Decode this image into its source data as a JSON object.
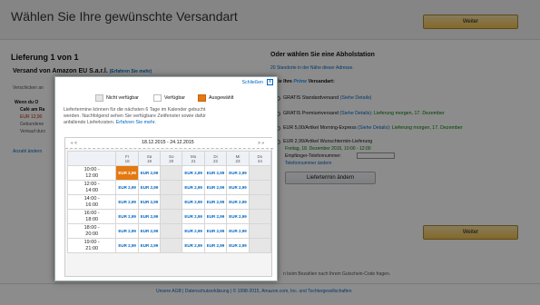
{
  "header": {
    "title": "Wählen Sie Ihre gewünschte Versandart",
    "continue_label": "Weiter"
  },
  "left": {
    "delivery_heading": "Lieferung 1 von 1",
    "shipper": "Versand von Amazon EU S.a.r.l.",
    "shipper_link": "(Erfahren Sie mehr)",
    "hidden_text": "Verschicken an",
    "bullet_title": "Wenn du O",
    "bullet_line2": "Café am Ra",
    "price": "EUR 12,90",
    "line3": "Gebundene",
    "line4": "Verkauf durc",
    "change_link": "Anzahl ändern"
  },
  "right": {
    "pickup_heading": "Oder wählen Sie eine Abholstation",
    "pickup_link": "20 Standorte in der Nähe dieser Adresse.",
    "prime_prefix": "n Sie Ihre",
    "prime_word": "Prime",
    "prime_suffix": "Versandart:",
    "options": [
      {
        "label": "GRATIS Standardversand",
        "link": "(Siehe Details)",
        "extra": ""
      },
      {
        "label": "GRATIS Premiumversand",
        "link": "(Siehe Details)",
        "extra": ": Lieferung morgen, 17. Dezember"
      },
      {
        "label": "EUR 5,00/Artikel Morning-Express",
        "link": "(Siehe Details)",
        "extra": ": Lieferung morgen, 17. Dezember"
      },
      {
        "label": "EUR 2,99/Artikel Wunschtermin-Lieferung",
        "link": "",
        "extra": ""
      }
    ],
    "wish_date": "Freitag, 18. Dezember 2015, 10:00 - 12:00",
    "phone_label": "Empfänger-Telefonnummer:",
    "phone_link": "Telefonnummer ändern",
    "change_date_button": "Liefertermin ändern",
    "continue_label": "Weiter",
    "note": "n beim Bezahlen nach Ihrem Gutschein-Code fragen."
  },
  "footer": {
    "text": "Unsere AGB | Datenschutzerklärung | © 1998-2015, Amazon.com, Inc. und Tochtergesellschaften"
  },
  "modal": {
    "close_label": "Schließen",
    "close_x": "x",
    "legend": {
      "unavailable": "Nicht verfügbar",
      "available": "Verfügbar",
      "selected": "Ausgewählt"
    },
    "info_text_1": "Liefertermine können für die nächsten 6 Tage im Kalender gebucht",
    "info_text_2": "werden. Nachfolgend sehen Sie verfügbare Zeitfenster sowie dafür",
    "info_text_3": "anfallende Lieferkosten.",
    "info_link": "Erfahren Sie mehr.",
    "date_range": "18.12.2015 - 24.12.2015",
    "prev": "« <",
    "next": "> »",
    "days": [
      {
        "name": "Fr",
        "num": "18"
      },
      {
        "name": "Sa",
        "num": "19"
      },
      {
        "name": "So",
        "num": "20"
      },
      {
        "name": "Mo",
        "num": "21"
      },
      {
        "name": "Di",
        "num": "22"
      },
      {
        "name": "Mi",
        "num": "23"
      },
      {
        "name": "Do",
        "num": "24"
      }
    ],
    "slot_price": "EUR 2,99",
    "times": [
      {
        "from": "10:00 -",
        "to": "12:00"
      },
      {
        "from": "12:00 -",
        "to": "14:00"
      },
      {
        "from": "14:00 -",
        "to": "16:00"
      },
      {
        "from": "16:00 -",
        "to": "18:00"
      },
      {
        "from": "18:00 -",
        "to": "20:00"
      },
      {
        "from": "19:00 -",
        "to": "21:00"
      }
    ]
  },
  "colors": {
    "selected": "#e47911",
    "link": "#0066c0",
    "button": "#f0c14b"
  }
}
